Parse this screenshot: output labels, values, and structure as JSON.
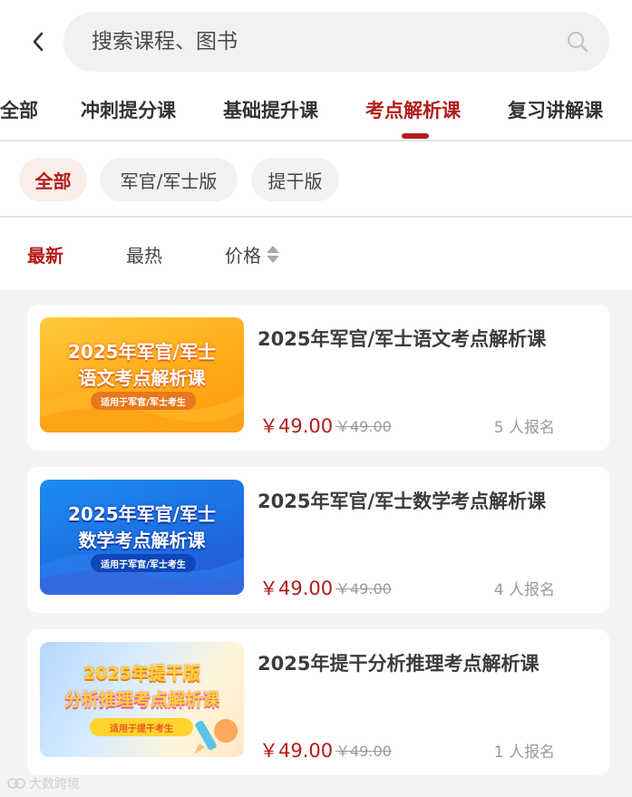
{
  "search": {
    "placeholder": "搜索课程、图书"
  },
  "tabs": [
    {
      "label": "全部"
    },
    {
      "label": "冲刺提分课"
    },
    {
      "label": "基础提升课"
    },
    {
      "label": "考点解析课"
    },
    {
      "label": "复习讲解课"
    }
  ],
  "active_tab": "考点解析课",
  "filters": [
    {
      "label": "全部"
    },
    {
      "label": "军官/军士版"
    },
    {
      "label": "提干版"
    }
  ],
  "active_filter": "全部",
  "sort": [
    {
      "label": "最新"
    },
    {
      "label": "最热"
    },
    {
      "label": "价格"
    }
  ],
  "active_sort": "最新",
  "courses": [
    {
      "title": "2025年军官/军士语文考点解析课",
      "cover_line1": "2025年军官/军士",
      "cover_line2": "语文考点解析课",
      "cover_badge": "适用于军官/军士考生",
      "price": "￥49.00",
      "original_price": "￥49.00",
      "enrolled": "5 人报名"
    },
    {
      "title": "2025年军官/军士数学考点解析课",
      "cover_line1": "2025年军官/军士",
      "cover_line2": "数学考点解析课",
      "cover_badge": "适用于军官/军士考生",
      "price": "￥49.00",
      "original_price": "￥49.00",
      "enrolled": "4 人报名"
    },
    {
      "title": "2025年提干分析推理考点解析课",
      "cover_line1": "2025年提干版",
      "cover_line2": "分析推理考点解析课",
      "cover_badge": "适用于提干考生",
      "price": "￥49.00",
      "original_price": "￥49.00",
      "enrolled": "1 人报名"
    }
  ],
  "watermark": "大数跨境",
  "colors": {
    "accent": "#b31c1c",
    "chip_active_bg": "#fbeee9",
    "list_bg": "#f4f4f6"
  },
  "icons": {
    "back": "chevron-left-icon",
    "search": "search-icon",
    "sort": "sort-arrows-icon"
  }
}
